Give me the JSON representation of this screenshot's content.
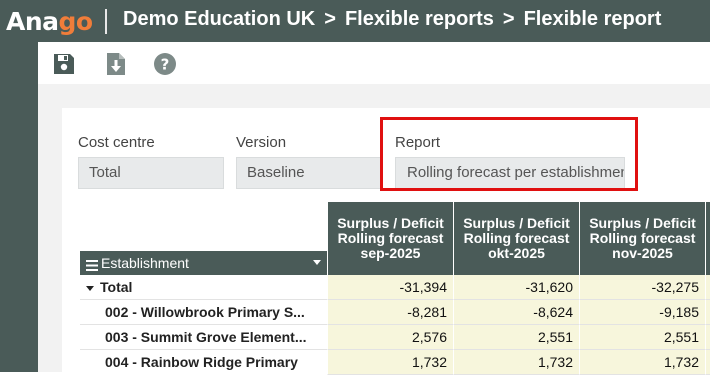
{
  "header": {
    "logo_part1": "Ana",
    "logo_part2": "go",
    "crumbs": [
      "Demo Education UK",
      "Flexible reports",
      "Flexible report"
    ],
    "separator": ">"
  },
  "toolbar": {
    "icons": [
      "save-icon",
      "download-icon",
      "help-icon"
    ]
  },
  "filters": {
    "cost_centre": {
      "label": "Cost centre",
      "value": "Total"
    },
    "version": {
      "label": "Version",
      "value": "Baseline"
    },
    "report": {
      "label": "Report",
      "value": "Rolling forecast per establishment"
    }
  },
  "grid": {
    "row_header_label": "Establishment",
    "columns": [
      {
        "line1": "Surplus / Deficit",
        "line2": "Rolling forecast",
        "line3": "sep-2025"
      },
      {
        "line1": "Surplus / Deficit",
        "line2": "Rolling forecast",
        "line3": "okt-2025"
      },
      {
        "line1": "Surplus / Deficit",
        "line2": "Rolling forecast",
        "line3": "nov-2025"
      }
    ],
    "rows": [
      {
        "label": "Total",
        "values": [
          "-31,394",
          "-31,620",
          "-32,275"
        ]
      },
      {
        "label": "002 - Willowbrook Primary S...",
        "values": [
          "-8,281",
          "-8,624",
          "-9,185"
        ]
      },
      {
        "label": "003 - Summit Grove Element...",
        "values": [
          "2,576",
          "2,551",
          "2,551"
        ]
      },
      {
        "label": "004 - Rainbow Ridge Primary",
        "values": [
          "1,732",
          "1,732",
          "1,732"
        ]
      }
    ]
  },
  "colors": {
    "header_bg": "#4a5b58",
    "logo_accent": "#f07d3a",
    "highlight": "#e01010",
    "cell_bg": "#f7f6dc"
  }
}
